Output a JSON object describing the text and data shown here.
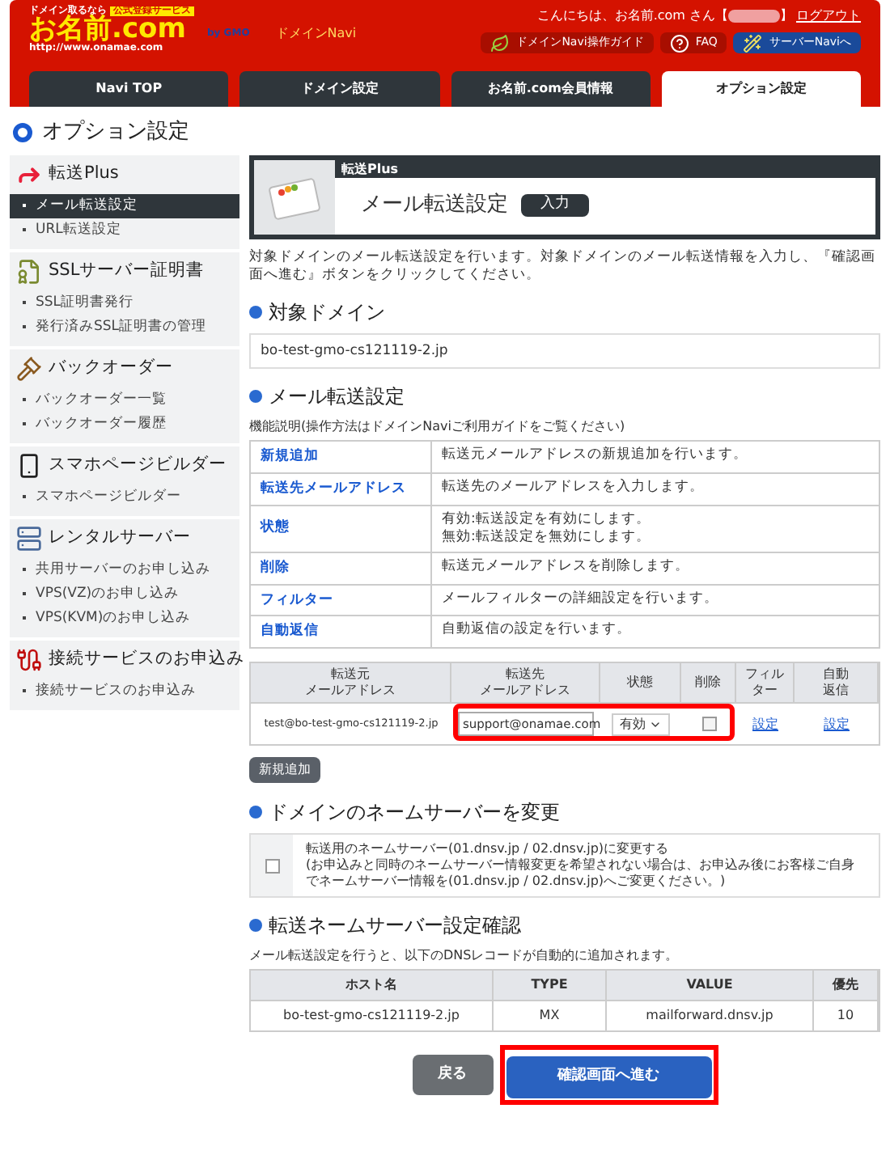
{
  "header": {
    "logo": {
      "tagline": "ドメイン取るなら",
      "badge": "公式登録サービス",
      "name": "お名前.com",
      "url": "http://www.onamae.com",
      "by": "by GMO"
    },
    "app_name": "ドメインNavi",
    "greeting": "こんにちは、お名前.com さん【",
    "greeting_end": "】",
    "logout": "ログアウト",
    "links": [
      {
        "kind": "guide",
        "label": "ドメインNavi操作ガイド"
      },
      {
        "kind": "faq",
        "label": "FAQ"
      },
      {
        "kind": "server",
        "label": "サーバーNaviへ"
      }
    ]
  },
  "tabs": [
    {
      "label": "Navi TOP",
      "selected": false
    },
    {
      "label": "ドメイン設定",
      "selected": false
    },
    {
      "label": "お名前.com会員情報",
      "selected": false
    },
    {
      "label": "オプション設定",
      "selected": true
    }
  ],
  "page_title": "オプション設定",
  "sidebar": [
    {
      "kind": "forward",
      "title": "転送Plus",
      "items": [
        {
          "label": "メール転送設定",
          "selected": true
        },
        {
          "label": "URL転送設定",
          "selected": false
        }
      ]
    },
    {
      "kind": "ssl",
      "title": "SSLサーバー証明書",
      "items": [
        {
          "label": "SSL証明書発行",
          "selected": false
        },
        {
          "label": "発行済みSSL証明書の管理",
          "selected": false
        }
      ]
    },
    {
      "kind": "backorder",
      "title": "バックオーダー",
      "items": [
        {
          "label": "バックオーダー一覧",
          "selected": false
        },
        {
          "label": "バックオーダー履歴",
          "selected": false
        }
      ]
    },
    {
      "kind": "phone",
      "title": "スマホページビルダー",
      "items": [
        {
          "label": "スマホページビルダー",
          "selected": false
        }
      ]
    },
    {
      "kind": "server",
      "title": "レンタルサーバー",
      "items": [
        {
          "label": "共用サーバーのお申し込み",
          "selected": false
        },
        {
          "label": "VPS(VZ)のお申し込み",
          "selected": false
        },
        {
          "label": "VPS(KVM)のお申し込み",
          "selected": false
        }
      ]
    },
    {
      "kind": "connect",
      "title": "接続サービスのお申込み",
      "items": [
        {
          "label": "接続サービスのお申込み",
          "selected": false
        }
      ]
    }
  ],
  "panel": {
    "category": "転送Plus",
    "title": "メール転送設定",
    "step": "入力"
  },
  "description": "対象ドメインのメール転送設定を行います。対象ドメインのメール転送情報を入力し、『確認画面へ進む』ボタンをクリックしてください。",
  "target_domain": {
    "heading": "対象ドメイン",
    "value": "bo-test-gmo-cs121119-2.jp"
  },
  "forward_settings": {
    "heading": "メール転送設定",
    "note": "機能説明(操作方法はドメインNaviご利用ガイドをご覧ください)",
    "help": [
      {
        "term": "新規追加",
        "text": "転送元メールアドレスの新規追加を行います。"
      },
      {
        "term": "転送先メールアドレス",
        "text": "転送先のメールアドレスを入力します。"
      },
      {
        "term": "状態",
        "lines": [
          "有効:転送設定を有効にします。",
          "無効:転送設定を無効にします。"
        ]
      },
      {
        "term": "削除",
        "text": "転送元メールアドレスを削除します。"
      },
      {
        "term": "フィルター",
        "text": "メールフィルターの詳細設定を行います。"
      },
      {
        "term": "自動返信",
        "text": "自動返信の設定を行います。"
      }
    ],
    "columns": [
      [
        "転送元",
        "メールアドレス"
      ],
      [
        "転送先",
        "メールアドレス"
      ],
      [
        "状態"
      ],
      [
        "削除"
      ],
      [
        "フィル",
        "ター"
      ],
      [
        "自動",
        "返信"
      ]
    ],
    "rows": [
      {
        "source": "test@bo-test-gmo-cs121119-2.jp",
        "destination": "support@onamae.com",
        "status": "有効",
        "delete_checked": false,
        "filter": "設定",
        "auto_reply": "設定"
      }
    ],
    "add_button": "新規追加"
  },
  "nameserver": {
    "heading": "ドメインのネームサーバーを変更",
    "checked": false,
    "label": "転送用のネームサーバー(01.dnsv.jp / 02.dnsv.jp)に変更する",
    "text": "(お申込みと同時のネームサーバー情報変更を希望されない場合は、お申込み後にお客様ご自身でネームサーバー情報を(01.dnsv.jp / 02.dnsv.jp)へご変更ください。)"
  },
  "dns_check": {
    "heading": "転送ネームサーバー設定確認",
    "note": "メール転送設定を行うと、以下のDNSレコードが自動的に追加されます。",
    "columns": [
      "ホスト名",
      "TYPE",
      "VALUE",
      "優先"
    ],
    "rows": [
      [
        "bo-test-gmo-cs121119-2.jp",
        "MX",
        "mailforward.dnsv.jp",
        "10"
      ]
    ]
  },
  "buttons": {
    "back": "戻る",
    "next": "確認画面へ進む"
  }
}
